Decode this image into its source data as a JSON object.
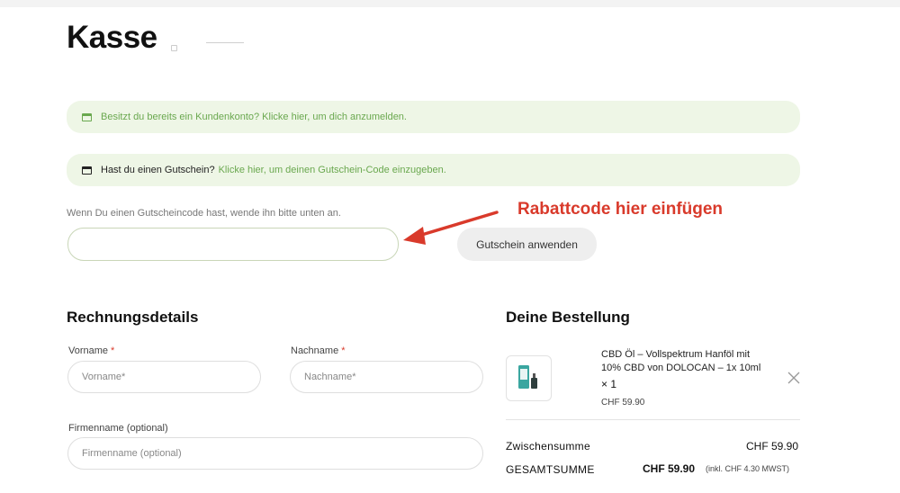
{
  "page": {
    "title": "Kasse"
  },
  "notices": {
    "login": {
      "text": "Besitzt du bereits ein Kundenkonto? Klicke hier, um dich anzumelden."
    },
    "coupon": {
      "prefix": "Hast du einen Gutschein?",
      "link": "Klicke hier, um deinen Gutschein-Code einzugeben."
    }
  },
  "coupon_form": {
    "help_text": "Wenn Du einen Gutscheincode hast, wende ihn bitte unten an.",
    "input_value": "",
    "button_label": "Gutschein anwenden",
    "annotation": "Rabattcode hier einfügen"
  },
  "billing": {
    "title": "Rechnungsdetails",
    "required_mark": "*",
    "fields": {
      "first_name": {
        "label": "Vorname",
        "placeholder": "Vorname*"
      },
      "last_name": {
        "label": "Nachname",
        "placeholder": "Nachname*"
      },
      "company": {
        "label": "Firmenname (optional)",
        "placeholder": "Firmenname (optional)"
      }
    }
  },
  "order": {
    "title": "Deine Bestellung",
    "item": {
      "name": "CBD Öl – Vollspektrum Hanföl mit 10% CBD von DOLOCAN – 1x 10ml",
      "quantity": "× 1",
      "price": "CHF 59.90"
    },
    "subtotal": {
      "label": "Zwischensumme",
      "value": "CHF 59.90"
    },
    "total": {
      "label": "GESAMTSUMME",
      "value": "CHF 59.90",
      "note": "(inkl. CHF 4.30 MWST)"
    }
  },
  "colors": {
    "accent_green": "#6aa84f",
    "annotation_red": "#d93a2b",
    "notice_bg": "#eef6e6"
  }
}
